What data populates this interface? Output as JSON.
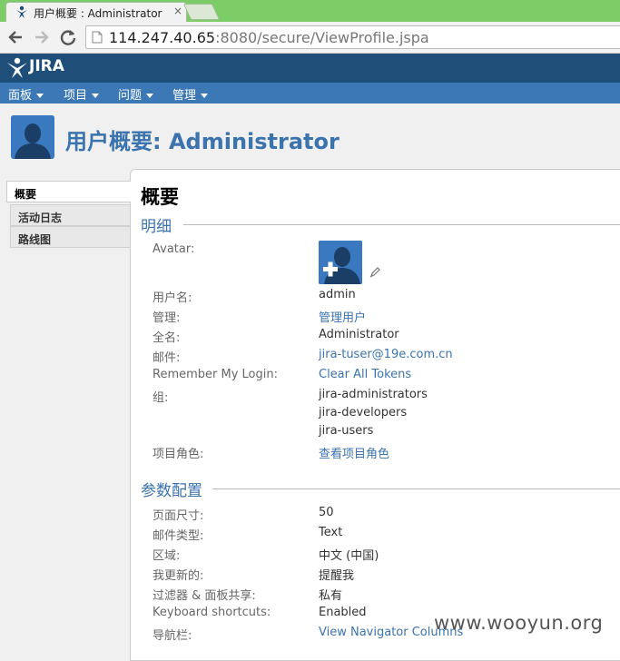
{
  "browser": {
    "tab_title": "用户概要 : Administrator",
    "tab_close": "×",
    "url_host": "114.247.40.65",
    "url_rest": ":8080/secure/ViewProfile.jspa"
  },
  "jira": {
    "logo_text": "JIRA",
    "nav": [
      "面板",
      "项目",
      "问题",
      "管理"
    ]
  },
  "page": {
    "title": "用户概要: Administrator"
  },
  "side_menu": [
    "概要",
    "活动日志",
    "路线图"
  ],
  "content": {
    "heading": "概要",
    "details_title": "明细",
    "details": {
      "avatar_label": "Avatar:",
      "username_label": "用户名:",
      "username_value": "admin",
      "admin_label": "管理:",
      "admin_link": "管理用户",
      "fullname_label": "全名:",
      "fullname_value": "Administrator",
      "email_label": "邮件:",
      "email_value": "jira-tuser@19e.com.cn",
      "remember_label": "Remember My Login:",
      "remember_link": "Clear All Tokens",
      "groups_label": "组:",
      "groups": [
        "jira-administrators",
        "jira-developers",
        "jira-users"
      ],
      "roles_label": "项目角色:",
      "roles_link": "查看项目角色"
    },
    "prefs_title": "参数配置",
    "prefs": [
      {
        "label": "页面尺寸:",
        "value": "50",
        "is_link": false
      },
      {
        "label": "邮件类型:",
        "value": "Text",
        "is_link": false
      },
      {
        "label": "区域:",
        "value": "中文 (中国)",
        "is_link": false
      },
      {
        "label": "我更新的:",
        "value": "提醒我",
        "is_link": false
      },
      {
        "label": "过滤器 & 面板共享:",
        "value": "私有",
        "is_link": false
      },
      {
        "label": "Keyboard shortcuts:",
        "value": "Enabled",
        "is_link": false
      },
      {
        "label": "导航栏:",
        "value": "View Navigator Columns",
        "is_link": true
      }
    ]
  },
  "watermark": "www.wooyun.org",
  "colors": {
    "header_dark": "#1f4e79",
    "nav_blue": "#3c78b5",
    "link_blue": "#3b73af",
    "tabstrip_green": "#7ccd68"
  }
}
